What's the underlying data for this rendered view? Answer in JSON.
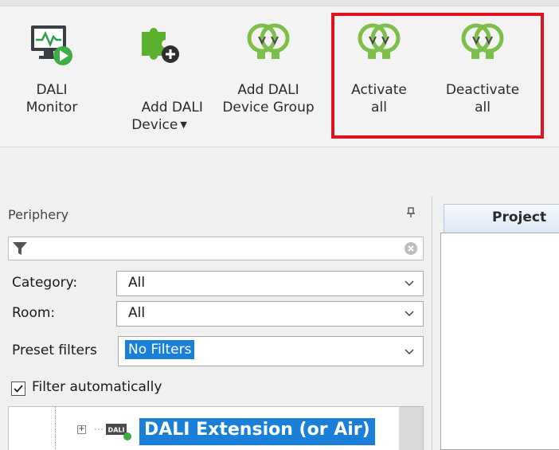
{
  "ribbon": {
    "buttons": [
      {
        "id": "dali-monitor",
        "label": "DALI\nMonitor",
        "icon": "monitor-play-icon"
      },
      {
        "id": "add-dali-device",
        "label": "Add DALI\nDevice",
        "icon": "puzzle-add-icon",
        "has_dropdown": true
      },
      {
        "id": "add-dali-device-group",
        "label": "Add DALI\nDevice Group",
        "icon": "double-bulb-icon"
      },
      {
        "id": "activate-all",
        "label": "Activate\nall",
        "icon": "double-bulb-icon"
      },
      {
        "id": "deactivate-all",
        "label": "Deactivate\nall",
        "icon": "double-bulb-icon"
      }
    ],
    "highlight_color": "#e0141e",
    "bulb_color": "#7cc04b"
  },
  "periphery": {
    "title": "Periphery",
    "filter": {
      "placeholder": ""
    },
    "category": {
      "label": "Category:",
      "value": "All"
    },
    "room": {
      "label": "Room:",
      "value": "All"
    },
    "preset_filters": {
      "label": "Preset filters",
      "value": "No Filters"
    },
    "filter_automatically": {
      "label": "Filter automatically",
      "checked": true
    },
    "tree": {
      "node_label": "DALI Extension (or Air)",
      "node_icon_text": "DALI"
    }
  },
  "document": {
    "tab_label": "Project"
  },
  "colors": {
    "selection": "#1a7fd9",
    "status_online": "#3cae3c"
  }
}
